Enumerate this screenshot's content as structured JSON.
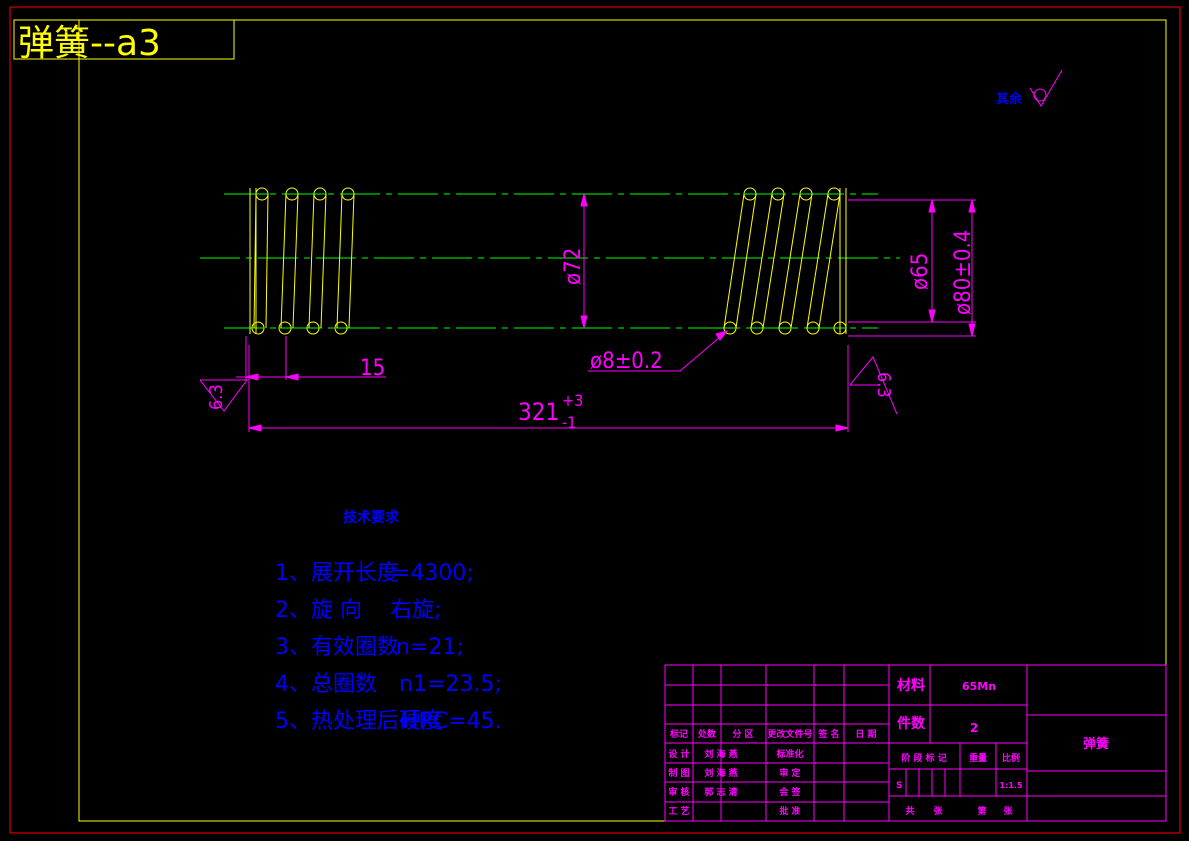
{
  "title": "弹簧--a3",
  "roughness_note": "其余",
  "dimensions": {
    "dia_72": "ø72",
    "dia_65": "ø65",
    "dia_80": "ø80±0.4",
    "wire": "ø8±0.2",
    "pitch_15": "15",
    "length_main": "321",
    "length_upper_tol": "+3",
    "length_lower_tol": "-1",
    "roughness_left": "6.3",
    "roughness_right": "6.3"
  },
  "tech_requirements": {
    "heading": "技术要求",
    "items": [
      {
        "label": "1、展开长度",
        "value": "=4300;"
      },
      {
        "label": "2、旋  向",
        "value": "右旋;"
      },
      {
        "label": "3、有效圈数",
        "value": "n=21;"
      },
      {
        "label": "4、总圈数",
        "value": "n1=23.5;"
      },
      {
        "label": "5、热处理后硬度",
        "value": "HRC=45."
      }
    ]
  },
  "title_block": {
    "material_label": "材料",
    "material_value": "65Mn",
    "qty_label": "件数",
    "qty_value": "2",
    "part_name": "弹簧",
    "header_row": [
      "标记",
      "处数",
      "分 区",
      "更改文件号",
      "签 名",
      "日 期"
    ],
    "rows": [
      {
        "role": "设 计",
        "name": "刘 海 燕",
        "role2": "标准化"
      },
      {
        "role": "制 图",
        "name": "刘 海 燕",
        "role2": "审 定"
      },
      {
        "role": "审 核",
        "name": "郭 志 清",
        "role2": "会 签"
      },
      {
        "role": "工 艺",
        "name": "",
        "role2": "批 准"
      }
    ],
    "stage_label": "阶 段 标 记",
    "weight_label": "重量",
    "scale_label": "比例",
    "stage_value": "S",
    "scale_value": "1:1.5",
    "sheet_text": [
      "共",
      "张",
      "第",
      "张"
    ]
  },
  "colors": {
    "frame": "#ff0000",
    "border": "#ffff00",
    "spring": "#ffff00",
    "centerline": "#00ff00",
    "dimension": "#ff00ff",
    "tech_text": "#0000ff",
    "roughness_note": "#0000ff"
  }
}
